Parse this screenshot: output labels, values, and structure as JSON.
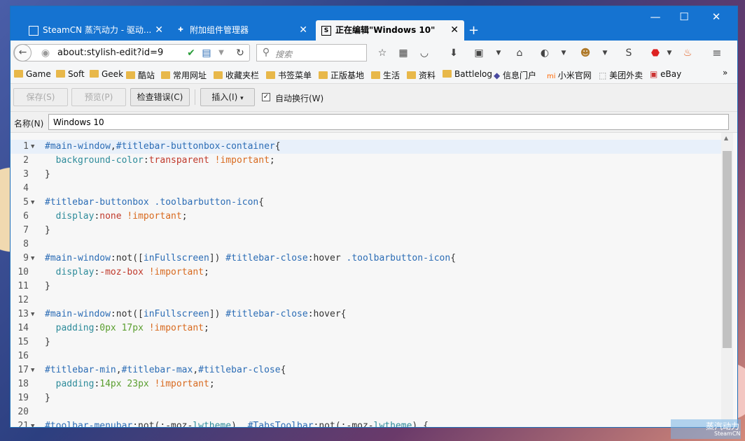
{
  "window_controls": {
    "minimize": "—",
    "maximize": "☐",
    "close": "✕"
  },
  "tabs": [
    {
      "label": "SteamCN 蒸汽动力 - 驱动...",
      "close": "✕"
    },
    {
      "label": "附加组件管理器",
      "close": "✕"
    },
    {
      "label": "正在编辑\"Windows 10\"",
      "close": "✕",
      "active": true
    }
  ],
  "new_tab": "+",
  "navbar": {
    "url": "about:stylish-edit?id=9",
    "search_placeholder": "搜索",
    "back": "←",
    "reload": "↻"
  },
  "bookmarks": [
    {
      "label": "Game",
      "icon": "folder-icon"
    },
    {
      "label": "Soft",
      "icon": "folder-icon"
    },
    {
      "label": "Geek",
      "icon": "folder-icon"
    },
    {
      "label": "酷站",
      "icon": "folder-icon"
    },
    {
      "label": "常用网址",
      "icon": "folder-icon"
    },
    {
      "label": "收藏夹栏",
      "icon": "folder-icon"
    },
    {
      "label": "书签菜单",
      "icon": "folder-icon"
    },
    {
      "label": "正版基地",
      "icon": "folder-icon"
    },
    {
      "label": "生活",
      "icon": "folder-icon"
    },
    {
      "label": "资料",
      "icon": "folder-icon"
    },
    {
      "label": "Battlelog",
      "icon": "folder-icon"
    },
    {
      "label": "信息门户",
      "icon": "diamond-icon"
    },
    {
      "label": "小米官网",
      "icon": "mi-icon"
    },
    {
      "label": "美团外卖",
      "icon": "dotted-icon"
    },
    {
      "label": "eBay",
      "icon": "ebay-icon"
    }
  ],
  "bookmarks_overflow": "»",
  "toolbar": {
    "save": "保存(S)",
    "preview": "预览(P)",
    "check_errors": "检查错误(C)",
    "insert": "插入(I)",
    "insert_arrow": "▾",
    "word_wrap": "自动换行(W)",
    "word_wrap_checked": "✓"
  },
  "name_row": {
    "label": "名称(N)",
    "value": "Windows 10"
  },
  "editor": {
    "lines": [
      {
        "n": "1",
        "fold": "▼",
        "code": [
          [
            "sel",
            "#main-window"
          ],
          [
            "pun",
            ","
          ],
          [
            "sel",
            "#titlebar-buttonbox-container"
          ],
          [
            "pun",
            "{"
          ]
        ]
      },
      {
        "n": "2",
        "fold": "",
        "code": [
          [
            "pun",
            "  "
          ],
          [
            "prop",
            "background-color"
          ],
          [
            "pun",
            ":"
          ],
          [
            "val",
            "transparent"
          ],
          [
            "pun",
            " "
          ],
          [
            "imp",
            "!important"
          ],
          [
            "pun",
            ";"
          ]
        ]
      },
      {
        "n": "3",
        "fold": "",
        "code": [
          [
            "pun",
            "}"
          ]
        ]
      },
      {
        "n": "4",
        "fold": "",
        "code": []
      },
      {
        "n": "5",
        "fold": "▼",
        "code": [
          [
            "sel",
            "#titlebar-buttonbox"
          ],
          [
            "pun",
            " "
          ],
          [
            "sel",
            ".toolbarbutton-icon"
          ],
          [
            "pun",
            "{"
          ]
        ]
      },
      {
        "n": "6",
        "fold": "",
        "code": [
          [
            "pun",
            "  "
          ],
          [
            "prop",
            "display"
          ],
          [
            "pun",
            ":"
          ],
          [
            "val",
            "none"
          ],
          [
            "pun",
            " "
          ],
          [
            "imp",
            "!important"
          ],
          [
            "pun",
            ";"
          ]
        ]
      },
      {
        "n": "7",
        "fold": "",
        "code": [
          [
            "pun",
            "}"
          ]
        ]
      },
      {
        "n": "8",
        "fold": "",
        "code": []
      },
      {
        "n": "9",
        "fold": "▼",
        "code": [
          [
            "sel",
            "#main-window"
          ],
          [
            "pun",
            ":not(["
          ],
          [
            "sel",
            "inFullscreen"
          ],
          [
            "pun",
            "]) "
          ],
          [
            "sel",
            "#titlebar-close"
          ],
          [
            "pun",
            ":hover "
          ],
          [
            "sel",
            ".toolbarbutton-icon"
          ],
          [
            "pun",
            "{"
          ]
        ]
      },
      {
        "n": "10",
        "fold": "",
        "code": [
          [
            "pun",
            "  "
          ],
          [
            "prop",
            "display"
          ],
          [
            "pun",
            ":"
          ],
          [
            "val",
            "-moz-box"
          ],
          [
            "pun",
            " "
          ],
          [
            "imp",
            "!important"
          ],
          [
            "pun",
            ";"
          ]
        ]
      },
      {
        "n": "11",
        "fold": "",
        "code": [
          [
            "pun",
            "}"
          ]
        ]
      },
      {
        "n": "12",
        "fold": "",
        "code": []
      },
      {
        "n": "13",
        "fold": "▼",
        "code": [
          [
            "sel",
            "#main-window"
          ],
          [
            "pun",
            ":not(["
          ],
          [
            "sel",
            "inFullscreen"
          ],
          [
            "pun",
            "]) "
          ],
          [
            "sel",
            "#titlebar-close"
          ],
          [
            "pun",
            ":hover{"
          ]
        ]
      },
      {
        "n": "14",
        "fold": "",
        "code": [
          [
            "pun",
            "  "
          ],
          [
            "prop",
            "padding"
          ],
          [
            "pun",
            ":"
          ],
          [
            "num",
            "0px 17px"
          ],
          [
            "pun",
            " "
          ],
          [
            "imp",
            "!important"
          ],
          [
            "pun",
            ";"
          ]
        ]
      },
      {
        "n": "15",
        "fold": "",
        "code": [
          [
            "pun",
            "}"
          ]
        ]
      },
      {
        "n": "16",
        "fold": "",
        "code": []
      },
      {
        "n": "17",
        "fold": "▼",
        "code": [
          [
            "sel",
            "#titlebar-min"
          ],
          [
            "pun",
            ","
          ],
          [
            "sel",
            "#titlebar-max"
          ],
          [
            "pun",
            ","
          ],
          [
            "sel",
            "#titlebar-close"
          ],
          [
            "pun",
            "{"
          ]
        ]
      },
      {
        "n": "18",
        "fold": "",
        "code": [
          [
            "pun",
            "  "
          ],
          [
            "prop",
            "padding"
          ],
          [
            "pun",
            ":"
          ],
          [
            "num",
            "14px 23px"
          ],
          [
            "pun",
            " "
          ],
          [
            "imp",
            "!important"
          ],
          [
            "pun",
            ";"
          ]
        ]
      },
      {
        "n": "19",
        "fold": "",
        "code": [
          [
            "pun",
            "}"
          ]
        ]
      },
      {
        "n": "20",
        "fold": "",
        "code": []
      },
      {
        "n": "21",
        "fold": "▼",
        "code": [
          [
            "sel",
            "#toolbar-menubar"
          ],
          [
            "pun",
            ":not(:-moz-"
          ],
          [
            "prop",
            "lwtheme"
          ],
          [
            "pun",
            "), "
          ],
          [
            "sel",
            "#TabsToolbar"
          ],
          [
            "pun",
            ":not(:-moz-"
          ],
          [
            "prop",
            "lwtheme"
          ],
          [
            "pun",
            ") {"
          ]
        ]
      }
    ]
  },
  "watermark": {
    "title": "蒸汽动力",
    "sub": "SteamCN"
  },
  "colors": {
    "titlebar": "#1573d1",
    "selector": "#2b6cb5",
    "property": "#2d8b9a",
    "value": "#c0392b",
    "number": "#5a9e2f",
    "important": "#d86a1f"
  }
}
